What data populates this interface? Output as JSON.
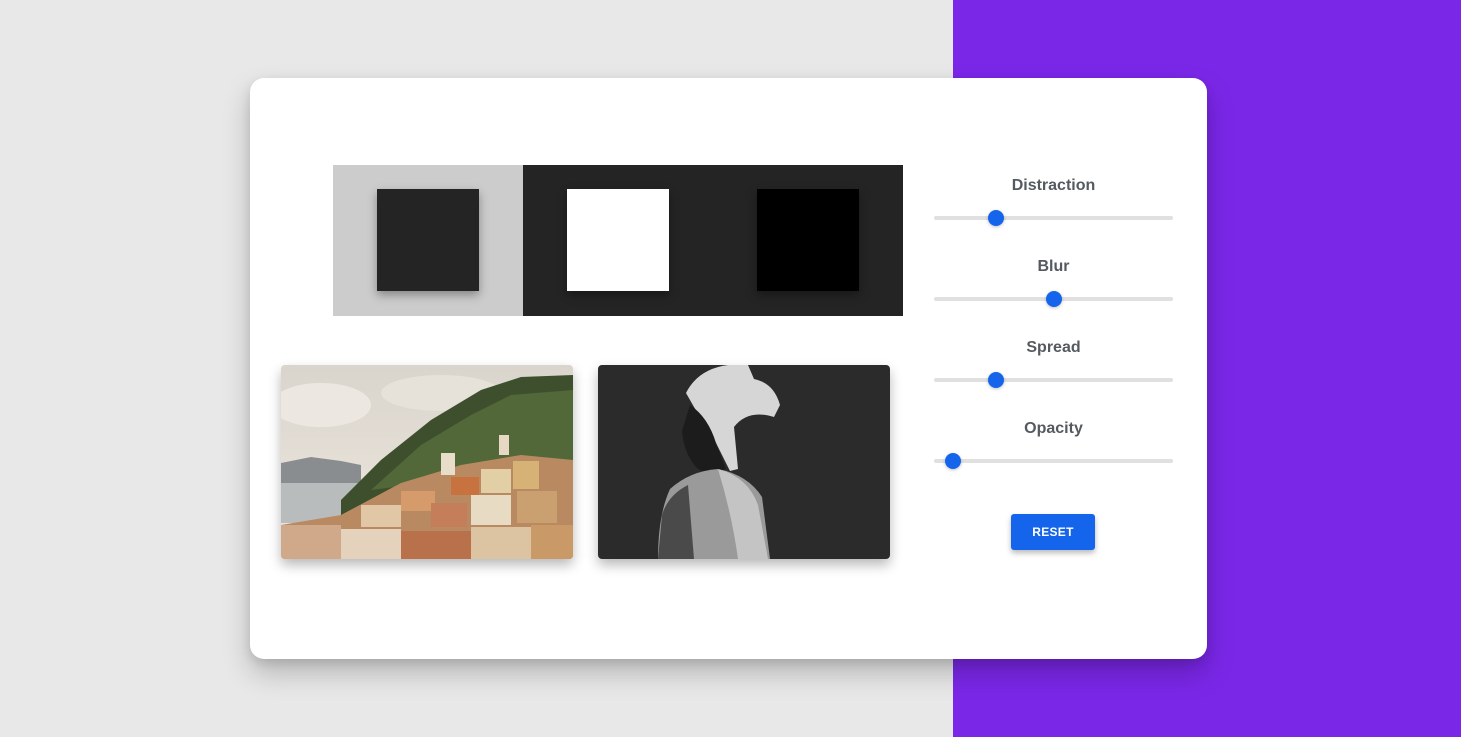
{
  "colors": {
    "page_background": "#e8e8e8",
    "accent_background": "#7b27e8",
    "card_background": "#ffffff",
    "primary": "#1565ec",
    "slider_track": "#e0e0e0",
    "label_text": "#555a60"
  },
  "swatches": [
    {
      "panel_color": "#cccccc",
      "square_color": "#242424"
    },
    {
      "panel_color": "#242424",
      "square_color": "#ffffff"
    },
    {
      "panel_color": "#242424",
      "square_color": "#000000"
    }
  ],
  "images": [
    {
      "name": "coastal-village-photo"
    },
    {
      "name": "man-in-white-hat-photo"
    }
  ],
  "controls": {
    "sliders": [
      {
        "label": "Distraction",
        "value": 0.26
      },
      {
        "label": "Blur",
        "value": 0.5
      },
      {
        "label": "Spread",
        "value": 0.26
      },
      {
        "label": "Opacity",
        "value": 0.08
      }
    ],
    "reset_label": "RESET"
  }
}
